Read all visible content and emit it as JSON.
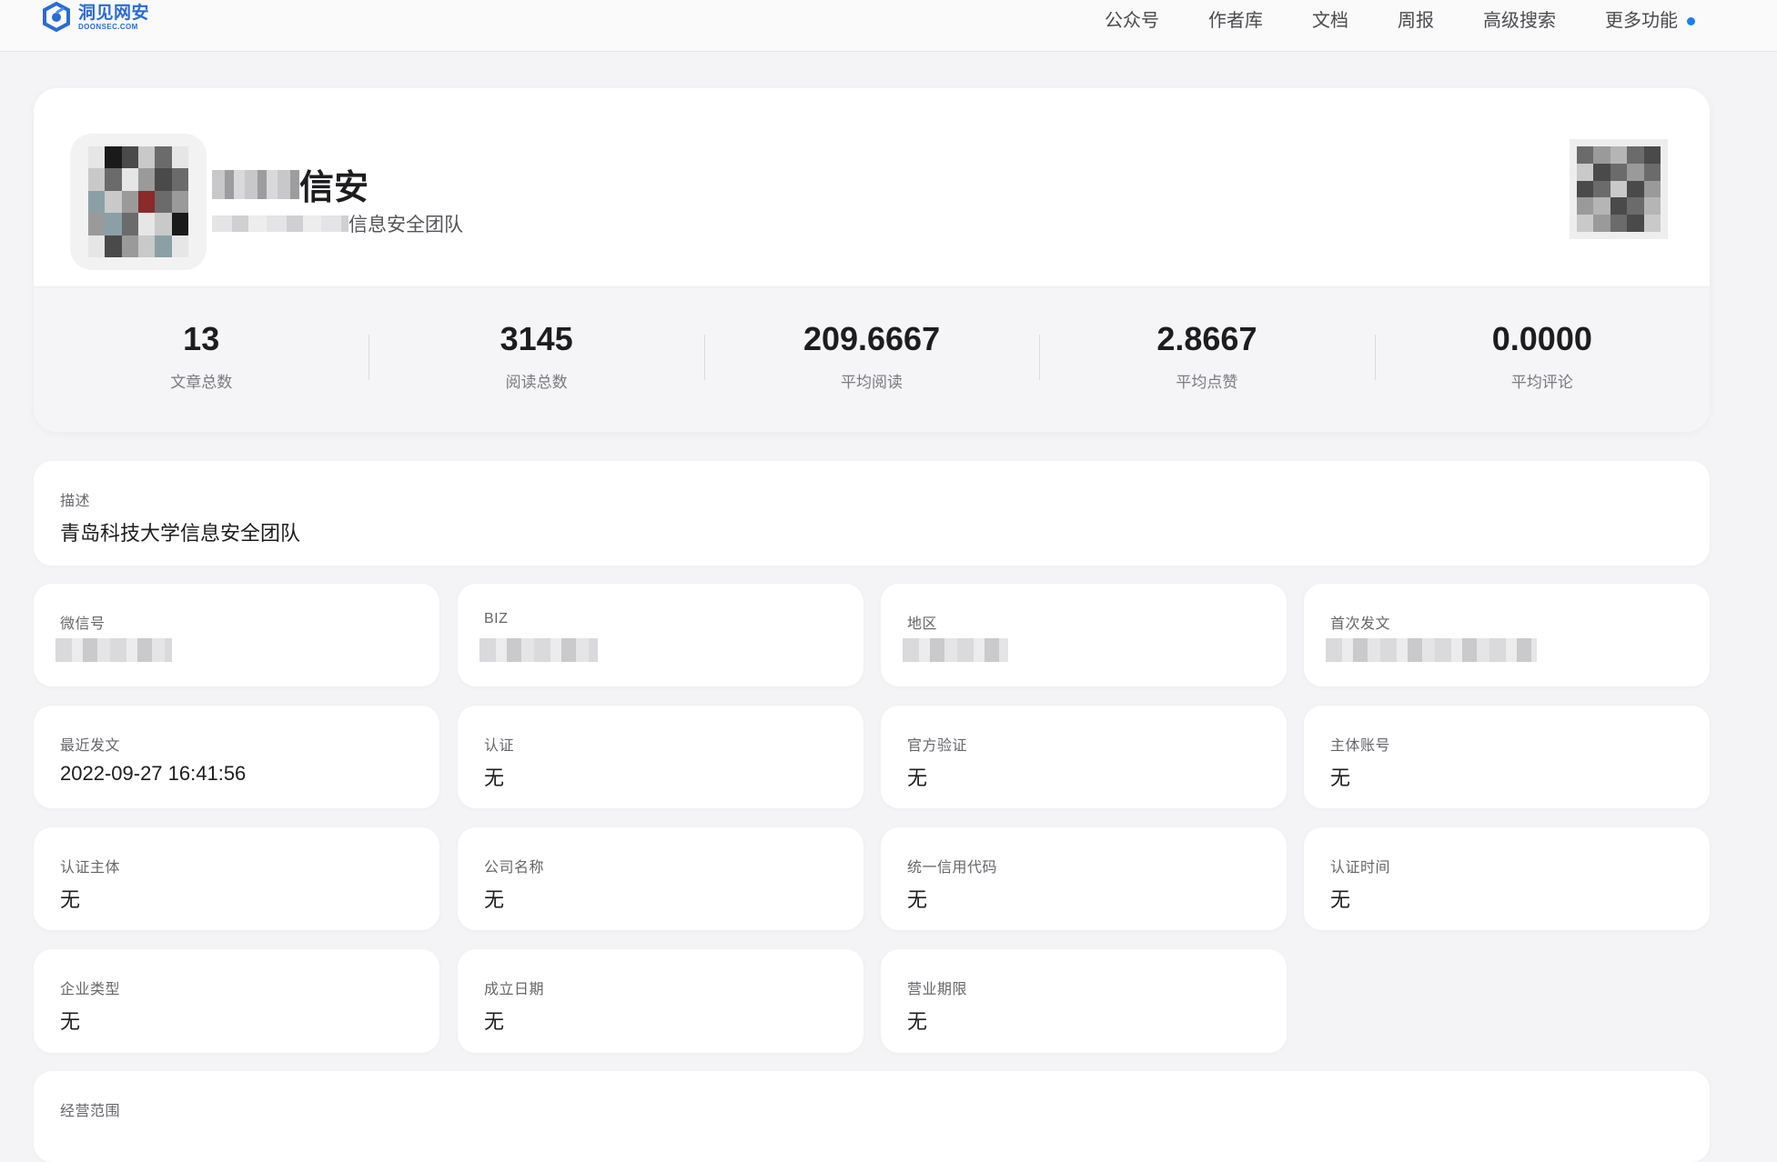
{
  "brand": {
    "cn": "洞见网安",
    "en": "DOONSEC.COM",
    "color": "#2a6bd4"
  },
  "nav": {
    "items": [
      "公众号",
      "作者库",
      "文档",
      "周报",
      "高级搜索",
      "更多功能"
    ],
    "dot_color": "#1a7ff0"
  },
  "profile": {
    "name_visible": "信安",
    "subtitle_visible": "信息安全团队"
  },
  "stats": [
    {
      "value": "13",
      "label": "文章总数"
    },
    {
      "value": "3145",
      "label": "阅读总数"
    },
    {
      "value": "209.6667",
      "label": "平均阅读"
    },
    {
      "value": "2.8667",
      "label": "平均点赞"
    },
    {
      "value": "0.0000",
      "label": "平均评论"
    }
  ],
  "description": {
    "label": "描述",
    "value": "青岛科技大学信息安全团队"
  },
  "fields": {
    "wechat_id": {
      "label": "微信号"
    },
    "biz": {
      "label": "BIZ"
    },
    "region": {
      "label": "地区"
    },
    "first_post": {
      "label": "首次发文"
    },
    "latest_post": {
      "label": "最近发文",
      "value": "2022-09-27 16:41:56"
    },
    "certification": {
      "label": "认证",
      "value": "无"
    },
    "official_verify": {
      "label": "官方验证",
      "value": "无"
    },
    "main_account": {
      "label": "主体账号",
      "value": "无"
    },
    "cert_subject": {
      "label": "认证主体",
      "value": "无"
    },
    "company_name": {
      "label": "公司名称",
      "value": "无"
    },
    "credit_code": {
      "label": "统一信用代码",
      "value": "无"
    },
    "cert_time": {
      "label": "认证时间",
      "value": "无"
    },
    "company_type": {
      "label": "企业类型",
      "value": "无"
    },
    "founded_date": {
      "label": "成立日期",
      "value": "无"
    },
    "business_term": {
      "label": "营业期限",
      "value": "无"
    }
  },
  "scope": {
    "label": "经营范围"
  }
}
